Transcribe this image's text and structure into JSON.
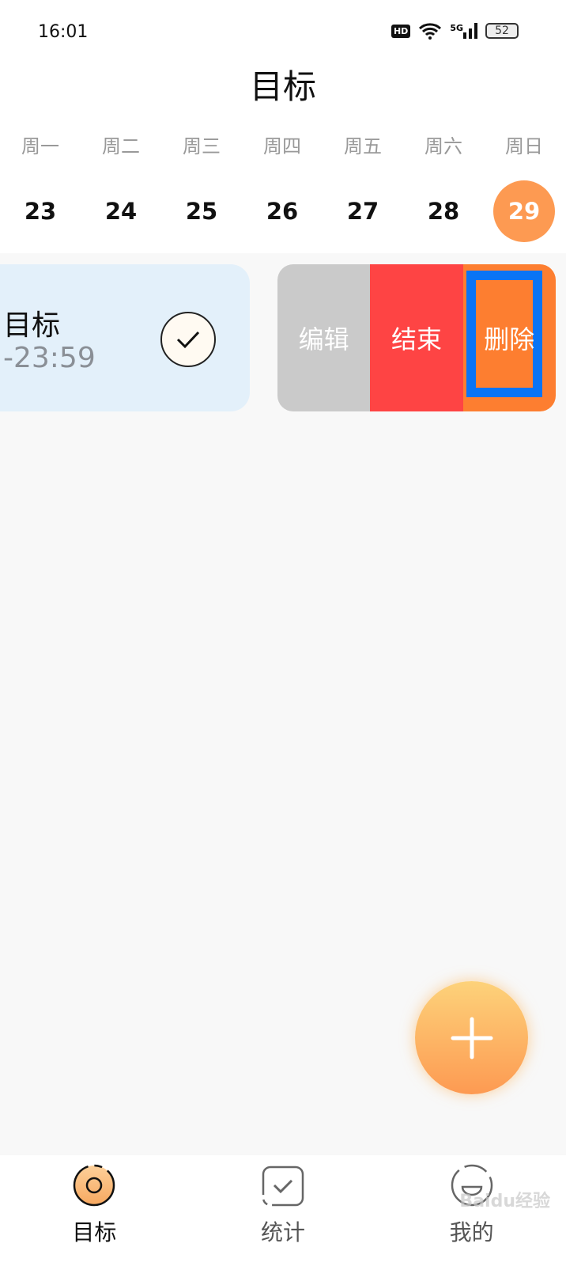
{
  "status": {
    "time": "16:01",
    "hd": "HD",
    "network": "5G",
    "battery": "52"
  },
  "header": {
    "title": "目标"
  },
  "week": {
    "days": [
      "周一",
      "周二",
      "周三",
      "周四",
      "周五",
      "周六",
      "周日"
    ],
    "dates": [
      "23",
      "24",
      "25",
      "26",
      "27",
      "28",
      "29"
    ],
    "selected": "29"
  },
  "goal_card": {
    "title": "目标",
    "time": "-23:59",
    "check_icon": "checkmark-icon"
  },
  "swipe_actions": {
    "edit": "编辑",
    "end": "结束",
    "delete": "删除"
  },
  "colors": {
    "accent": "#fd9a52",
    "edit": "#cacaca",
    "end": "#fe4444",
    "delete": "#fd7e30",
    "highlight": "#0a74f5",
    "card": "#e3f0fa"
  },
  "nav": {
    "items": [
      {
        "label": "目标",
        "icon": "target-icon"
      },
      {
        "label": "统计",
        "icon": "stats-check-icon"
      },
      {
        "label": "我的",
        "icon": "smile-icon"
      }
    ]
  },
  "watermark": "Baidu经验"
}
